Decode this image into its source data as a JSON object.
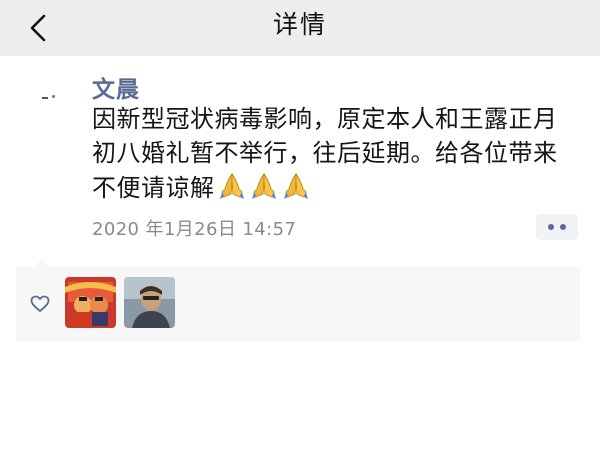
{
  "nav": {
    "title": "详情"
  },
  "post": {
    "author": "文晨",
    "text": "因新型冠状病毒影响，原定本人和王露正月初八婚礼暂不举行，往后延期。给各位带来不便请谅解",
    "emoji": [
      "folded-hands",
      "folded-hands",
      "folded-hands"
    ],
    "timestamp": "2020 年1月26日 14:57"
  },
  "likes": {
    "icon": "heart-icon",
    "users": [
      "liker-avatar-1",
      "liker-avatar-2"
    ]
  },
  "colors": {
    "navbar": "#ededed",
    "author": "#576b95",
    "text": "#151515",
    "timestamp": "#8a8a8a",
    "likes_bg": "#f7f7f7"
  }
}
